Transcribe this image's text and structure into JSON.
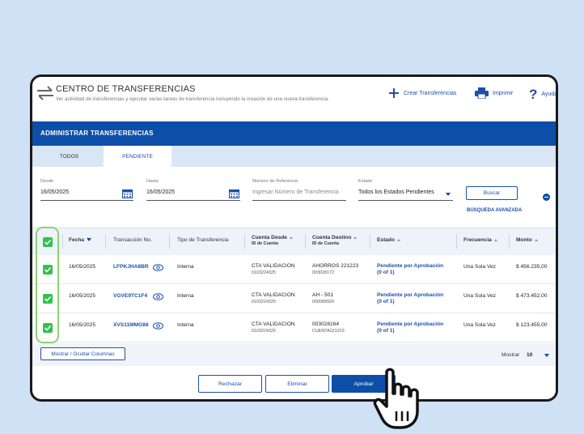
{
  "header": {
    "title": "CENTRO DE TRANSFERENCIAS",
    "subtitle": "Ver actividad de transferencias y ejecutar varias tareas de transferencia incluyendo la creación de una nueva transferencia.",
    "create_label": "Crear Transferencias",
    "print_label": "Imprimir",
    "help_label": "Ayuda"
  },
  "band": {
    "title": "ADMINISTRAR TRANSFERENCIAS"
  },
  "tabs": [
    {
      "label": "TODOS",
      "active": false
    },
    {
      "label": "PENDIENTE",
      "active": true
    }
  ],
  "filters": {
    "desde_label": "Desde",
    "desde_value": "16/05/2025",
    "hasta_label": "Hasta",
    "hasta_value": "16/05/2025",
    "ref_label": "Número de Referencia",
    "ref_placeholder": "Ingresar Número de Transferencia",
    "estado_label": "Estado",
    "estado_value": "Todos los Estados Pendientes",
    "search_button": "Buscar",
    "advanced_search": "BÚSQUEDA AVANZADA"
  },
  "table": {
    "columns": {
      "fecha": "Fecha",
      "transaccion": "Transacción No.",
      "tipo": "Tipo de Transferencia",
      "desde": "Cuenta Desde",
      "desde_sub": "ID de Cuenta",
      "destino": "Cuenta Destino",
      "destino_sub": "ID de Cuenta",
      "estado": "Estado",
      "frecuencia": "Frecuencia",
      "monto": "Monto"
    },
    "rows": [
      {
        "checked": true,
        "fecha": "16/05/2025",
        "transaccion": "LFPKJHA8BR",
        "tipo": "Interna",
        "desde": "CTA VALIDACION",
        "desde_id": "0103224325",
        "destino": "AHORROS 221223",
        "destino_id": "003028172",
        "estado": "Pendiente por Aprobación",
        "estado_sub": "(0 of 1)",
        "frecuencia": "Una Sola Vez",
        "monto": "$ 456.235,00"
      },
      {
        "checked": true,
        "fecha": "16/05/2025",
        "transaccion": "VGVE9TC1F4",
        "tipo": "Interna",
        "desde": "CTA VALIDACION",
        "desde_id": "0103224325",
        "destino": "AH - 501",
        "destino_id": "000089920",
        "estado": "Pendiente por Aprobación",
        "estado_sub": "(0 of 1)",
        "frecuencia": "Una Sola Vez",
        "monto": "$ 473.452,00"
      },
      {
        "checked": true,
        "fecha": "16/05/2025",
        "transaccion": "XVS11MMG86",
        "tipo": "Interna",
        "desde": "CTA VALIDACION",
        "desde_id": "0103224325",
        "destino": "003028164",
        "destino_id": "CUENTA221223",
        "estado": "Pendiente por Aprobación",
        "estado_sub": "(0 of 1)",
        "frecuencia": "Una Sola Vez",
        "monto": "$ 123.455,00"
      }
    ]
  },
  "footer": {
    "columns_button": "Mostrar / Ocultar Columnas",
    "show_label": "Mostrar",
    "show_value": "10"
  },
  "actions": {
    "reject": "Rechazar",
    "delete": "Eliminar",
    "approve": "Aprobar"
  },
  "colors": {
    "brand_blue": "#0d4ea8",
    "check_green": "#2ec44a",
    "highlight_green": "#89d36e",
    "background": "#cfe1f5"
  }
}
